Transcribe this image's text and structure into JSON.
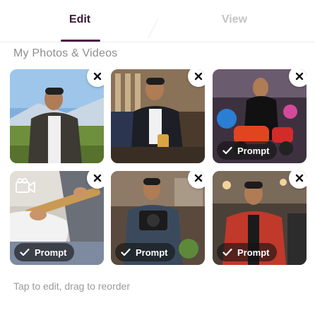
{
  "tabs": {
    "edit": "Edit",
    "view": "View",
    "active": "edit"
  },
  "section": {
    "title": "My Photos & Videos"
  },
  "tiles": [
    {
      "prompt": "",
      "has_prompt": false,
      "is_video": false
    },
    {
      "prompt": "",
      "has_prompt": false,
      "is_video": false
    },
    {
      "prompt": "Prompt",
      "has_prompt": true,
      "is_video": false
    },
    {
      "prompt": "Prompt",
      "has_prompt": true,
      "is_video": true
    },
    {
      "prompt": "Prompt",
      "has_prompt": true,
      "is_video": false
    },
    {
      "prompt": "Prompt",
      "has_prompt": true,
      "is_video": false
    }
  ],
  "icons": {
    "remove": "close-icon",
    "prompt": "checkmark-icon",
    "video": "video-camera-icon"
  },
  "footer": {
    "hint": "Tap to edit, drag to reorder"
  },
  "colors": {
    "accent": "#4a1d43",
    "inactive_tab": "#c4c4c4",
    "muted_text": "#8d8d8d"
  }
}
